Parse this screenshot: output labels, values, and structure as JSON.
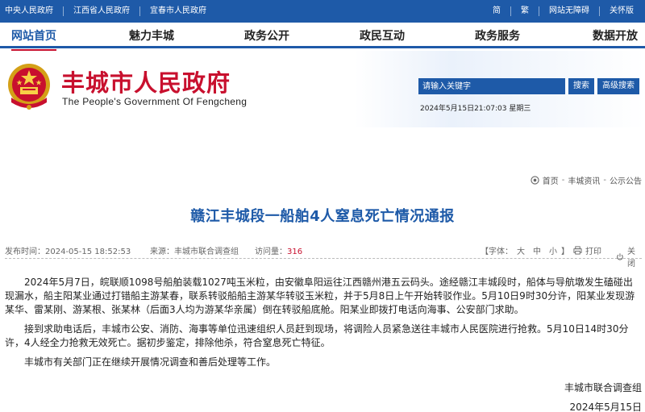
{
  "topbar": {
    "left_links": [
      "中央人民政府",
      "江西省人民政府",
      "宜春市人民政府"
    ],
    "right_links": [
      "简",
      "繁",
      "网站无障碍",
      "关怀版"
    ]
  },
  "nav": {
    "items": [
      "网站首页",
      "魅力丰城",
      "政务公开",
      "政民互动",
      "政务服务",
      "数据开放"
    ]
  },
  "header": {
    "title": "丰城市人民政府",
    "subtitle": "The People's Government Of Fengcheng",
    "search_placeholder": "请输入关键字",
    "search_button": "搜索",
    "advanced_search_button": "高级搜索",
    "datetime": "2024年5月15日21:07:03 星期三"
  },
  "breadcrumb": [
    "首页",
    "丰城资讯",
    "公示公告"
  ],
  "article": {
    "title": "赣江丰城段一船舶4人窒息死亡情况通报",
    "pubtime": "发布时间：2024-05-15 18:52:53",
    "source": "来源：丰城市联合调查组",
    "visits_label": "访问量：",
    "visits_value": "316",
    "fontsize_label": "【字体：",
    "fontsize_big": "大",
    "fontsize_mid": "中",
    "fontsize_small": "小",
    "fontsize_end": "】",
    "print_label": "打印",
    "close_label": "关闭",
    "paragraphs": [
      "2024年5月7日，皖联顺1098号船舶装载1027吨玉米粒，由安徽阜阳运往江西赣州港五云码头。途经赣江丰城段时，船体与导航墩发生磕碰出现漏水，船主阳某业通过打错船主游某春，联系转驳船船主游某华转驳玉米粒，并于5月8日上午开始转驳作业。5月10日9时30分许，阳某业发现游某华、雷某刚、游某根、张某林（后面3人均为游某华亲属）倒在转驳船底舱。阳某业即拨打电话向海事、公安部门求助。",
      "接到求助电话后，丰城市公安、消防、海事等单位迅速组织人员赶到现场，将调险人员紧急送往丰城市人民医院进行抢救。5月10日14时30分许，4人经全力抢救无效死亡。据初步鉴定，排除他杀，符合窒息死亡特征。",
      "丰城市有关部门正在继续开展情况调查和善后处理等工作。"
    ],
    "sign_org": "丰城市联合调查组",
    "sign_date": "2024年5月15日"
  },
  "colors": {
    "brand_blue": "#1e5aa8",
    "title_red": "#c8102e"
  }
}
